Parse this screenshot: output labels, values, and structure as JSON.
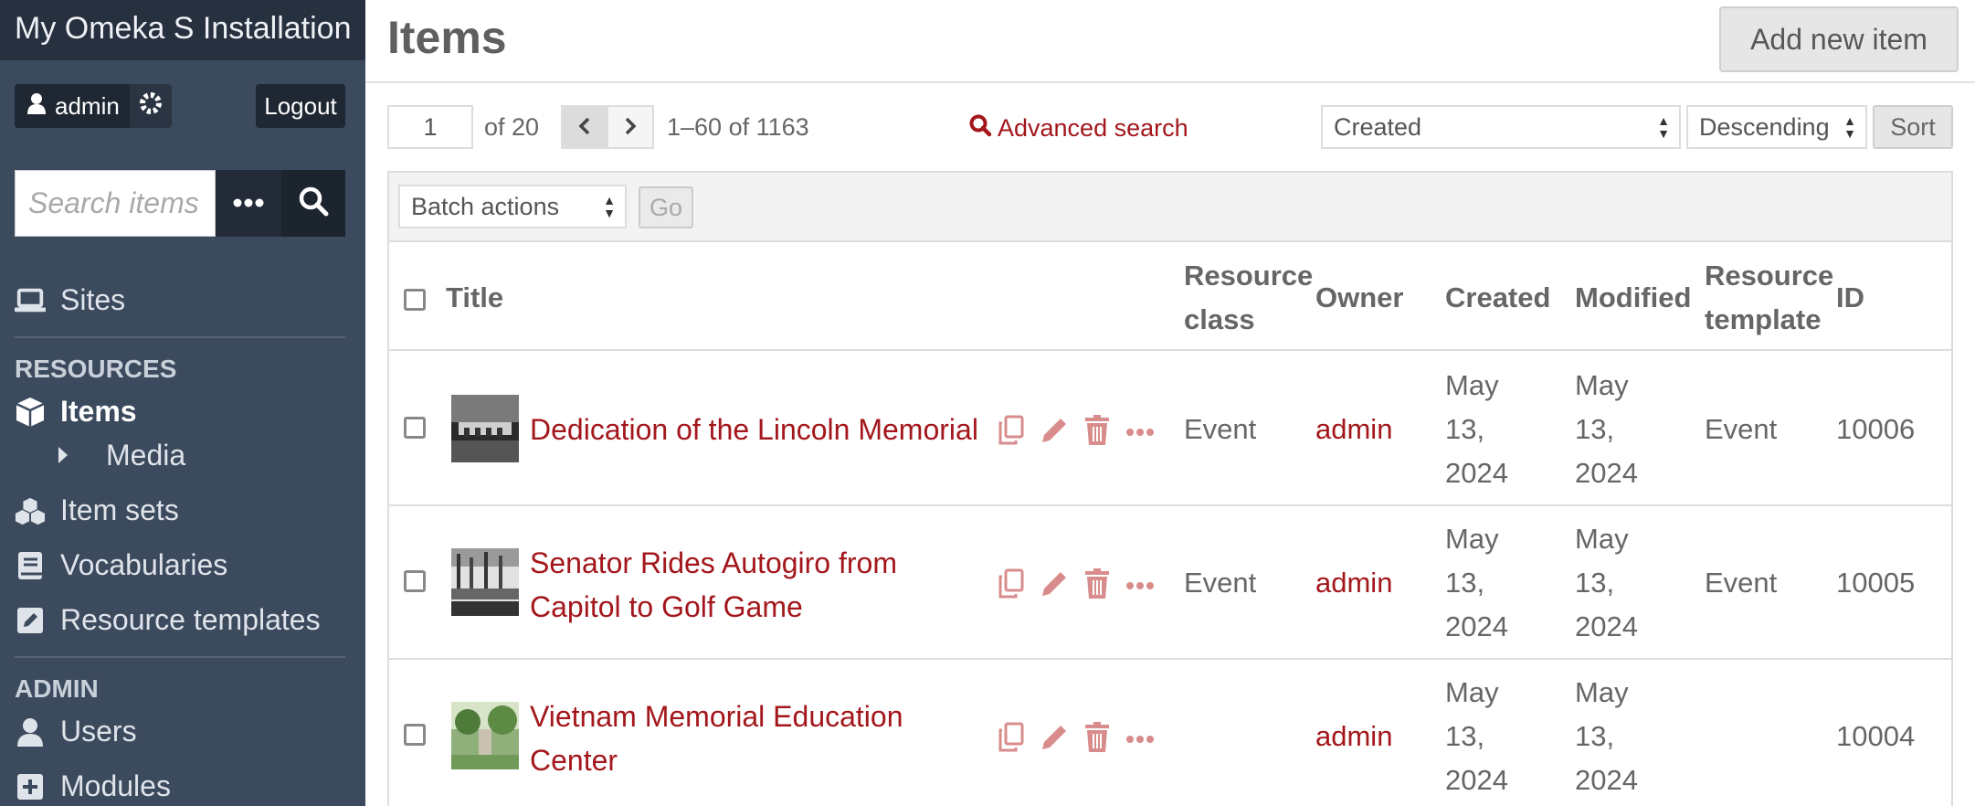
{
  "app": {
    "title": "My Omeka S Installation",
    "user_label": "admin",
    "logout_label": "Logout",
    "search_placeholder": "Search items"
  },
  "nav": {
    "sites": "Sites",
    "resources_heading": "RESOURCES",
    "items": "Items",
    "media": "Media",
    "item_sets": "Item sets",
    "vocabularies": "Vocabularies",
    "resource_templates": "Resource templates",
    "admin_heading": "ADMIN",
    "users": "Users",
    "modules": "Modules"
  },
  "header": {
    "title": "Items",
    "add_button": "Add new item"
  },
  "pagination": {
    "page": "1",
    "of_label": "of 20",
    "range": "1–60 of 1163",
    "advanced_search": "Advanced search"
  },
  "sort": {
    "by": "Created",
    "order": "Descending",
    "button": "Sort"
  },
  "batch": {
    "select": "Batch actions",
    "go": "Go"
  },
  "table": {
    "headers": {
      "title": "Title",
      "resource_class_1": "Resource",
      "resource_class_2": "class",
      "owner": "Owner",
      "created": "Created",
      "modified": "Modified",
      "resource_template_1": "Resource",
      "resource_template_2": "template",
      "id": "ID"
    },
    "rows": [
      {
        "title_1": "Dedication of the Lincoln Memorial",
        "title_2": "",
        "resource_class": "Event",
        "owner": "admin",
        "created_1": "May",
        "created_2": "13,",
        "created_3": "2024",
        "modified_1": "May",
        "modified_2": "13,",
        "modified_3": "2024",
        "resource_template": "Event",
        "id": "10006"
      },
      {
        "title_1": "Senator Rides Autogiro from",
        "title_2": "Capitol to Golf Game",
        "resource_class": "Event",
        "owner": "admin",
        "created_1": "May",
        "created_2": "13,",
        "created_3": "2024",
        "modified_1": "May",
        "modified_2": "13,",
        "modified_3": "2024",
        "resource_template": "Event",
        "id": "10005"
      },
      {
        "title_1": "Vietnam Memorial Education",
        "title_2": "Center",
        "resource_class": "",
        "owner": "admin",
        "created_1": "May",
        "created_2": "13,",
        "created_3": "2024",
        "modified_1": "May",
        "modified_2": "13,",
        "modified_3": "2024",
        "resource_template": "",
        "id": "10004"
      }
    ]
  },
  "colors": {
    "sidebar_bg": "#3c4a5e",
    "brand_bg": "#26303e",
    "link": "#a3171c"
  }
}
